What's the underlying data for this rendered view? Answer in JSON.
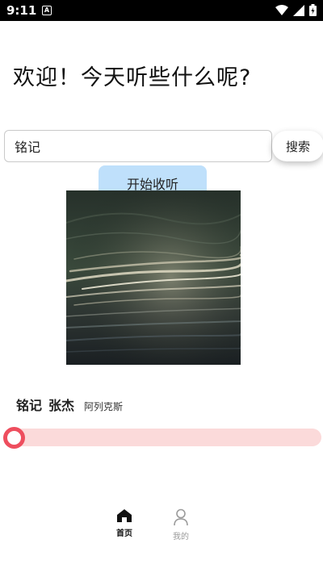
{
  "status_bar": {
    "time": "9:11",
    "notification_icon": "A",
    "icons": [
      "wifi-icon",
      "signal-icon",
      "battery-icon"
    ]
  },
  "greeting": "欢迎！今天听些什么呢?",
  "search": {
    "value": "铭记",
    "button_label": "搜索"
  },
  "start_button_label": "开始收听",
  "now_playing": {
    "title": "铭记",
    "artist": "张杰",
    "album": "阿列克斯",
    "progress": 0
  },
  "bottom_nav": {
    "items": [
      {
        "label": "首页",
        "icon": "home-icon",
        "active": true
      },
      {
        "label": "我的",
        "icon": "user-icon",
        "active": false
      }
    ]
  },
  "colors": {
    "accent": "#ee4e5e",
    "progress_track": "#fbdada",
    "start_button_bg": "#bfe0fb"
  }
}
